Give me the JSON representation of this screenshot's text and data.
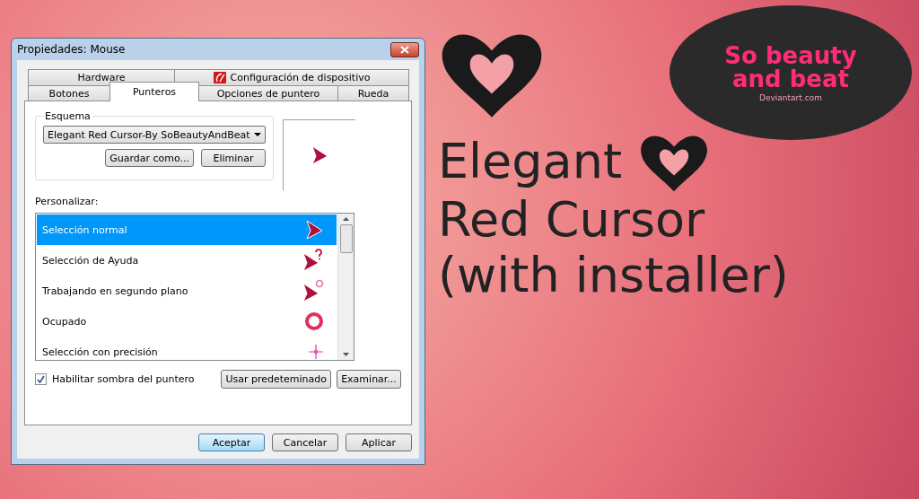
{
  "window": {
    "title": "Propiedades: Mouse"
  },
  "tabs_top": [
    {
      "label": "Hardware",
      "selected": false
    },
    {
      "label": "Configuración de dispositivo",
      "selected": false
    }
  ],
  "tabs": [
    {
      "label": "Botones",
      "selected": false
    },
    {
      "label": "Punteros",
      "selected": true
    },
    {
      "label": "Opciones de puntero",
      "selected": false
    },
    {
      "label": "Rueda",
      "selected": false
    }
  ],
  "scheme": {
    "label": "Esquema",
    "value": "Elegant Red Cursor-By SoBeautyAndBeat",
    "buttons": [
      "Guardar como...",
      "Eliminar"
    ]
  },
  "customize": {
    "label": "Personalizar:",
    "items": [
      {
        "label": "Selección normal",
        "selected": true,
        "kind": "arrow"
      },
      {
        "label": "Selección de Ayuda",
        "selected": false,
        "kind": "help"
      },
      {
        "label": "Trabajando en segundo plano",
        "selected": false,
        "kind": "working"
      },
      {
        "label": "Ocupado",
        "selected": false,
        "kind": "busy"
      },
      {
        "label": "Selección con precisión",
        "selected": false,
        "kind": "precision"
      }
    ]
  },
  "shadow": {
    "label": "Habilitar sombra del puntero",
    "checked": true
  },
  "list_buttons": [
    "Usar predeteminado",
    "Examinar..."
  ],
  "dialog_buttons": [
    {
      "label": "Aceptar",
      "default": true
    },
    {
      "label": "Cancelar",
      "default": false
    },
    {
      "label": "Aplicar",
      "default": false
    }
  ],
  "poster": {
    "title_lines": [
      "Elegant",
      "Red Cursor",
      "(with installer)"
    ],
    "logo": {
      "lines": [
        "So beauty",
        "and beat"
      ],
      "site": "Deviantart.com"
    }
  }
}
